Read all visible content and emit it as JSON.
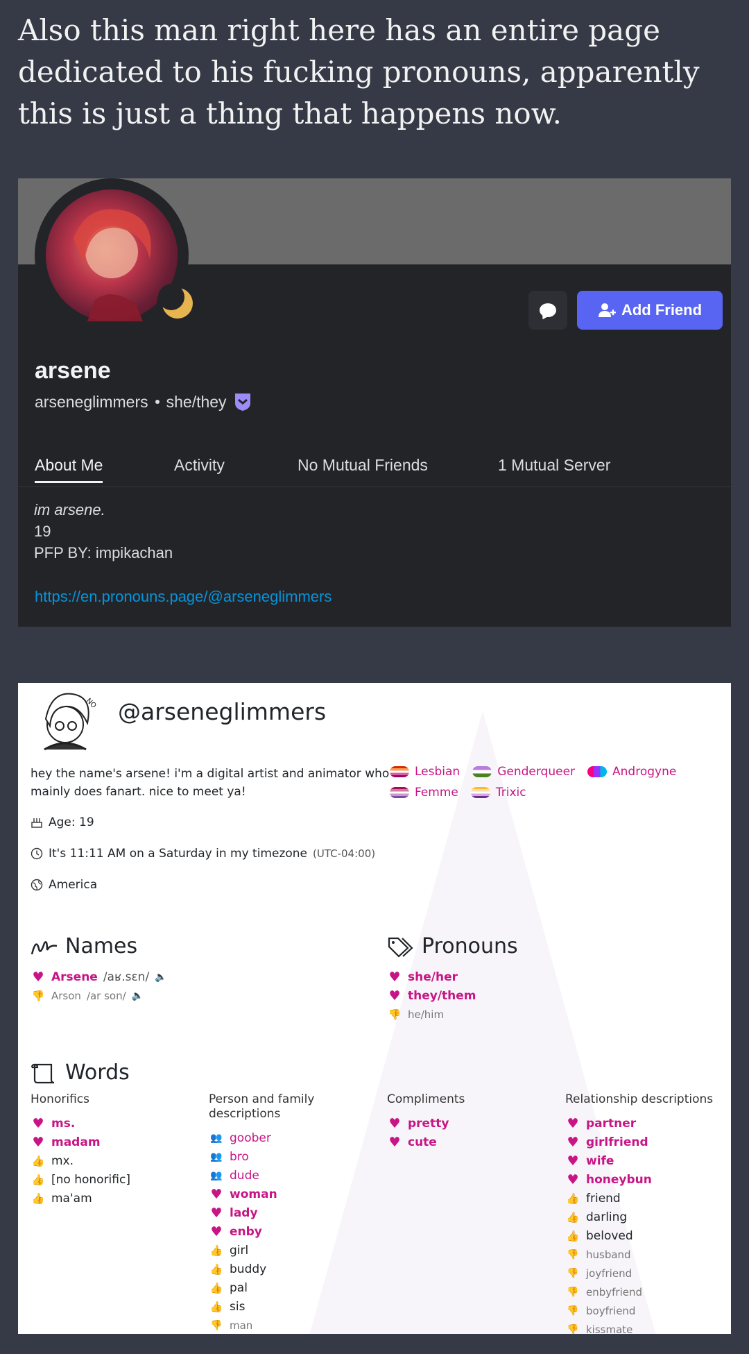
{
  "post": {
    "text": "Also this man right here has an entire page dedicated to his fucking pronouns, apparently this is just a thing that happens now."
  },
  "discord": {
    "display_name": "arsene",
    "username": "arseneglimmers",
    "pronouns": "she/they",
    "add_friend_label": "Add Friend",
    "tabs": [
      "About Me",
      "Activity",
      "No Mutual Friends",
      "1 Mutual Server"
    ],
    "about": {
      "line1": "im arsene.",
      "line2": "19",
      "line3": "PFP BY: impikachan",
      "link": "https://en.pronouns.page/@arseneglimmers"
    },
    "colors": {
      "accent": "#5865f2",
      "background": "#232428",
      "banner": "#6b6b6b",
      "status": "#e7b450"
    }
  },
  "pronouns_page": {
    "handle": "@arseneglimmers",
    "bio": "hey the name's arsene! i'm a digital artist and animator who mainly does fanart. nice to meet ya!",
    "flags": [
      {
        "label": "Lesbian",
        "colors": [
          "#d52d00",
          "#ff9a56",
          "#ffffff",
          "#d362a4",
          "#a30262"
        ]
      },
      {
        "label": "Genderqueer",
        "colors": [
          "#b57edc",
          "#ffffff",
          "#4a8123"
        ]
      },
      {
        "label": "Androgyne",
        "colors": [
          "#fe007f",
          "#9832ff",
          "#00b8e7"
        ]
      },
      {
        "label": "Femme",
        "colors": [
          "#a70b59",
          "#d07b9d",
          "#ffffff",
          "#c59bd0",
          "#7f4ba1"
        ]
      },
      {
        "label": "Trixic",
        "colors": [
          "#fcbb2e",
          "#ffdfa6",
          "#ffffff",
          "#d8a5e8",
          "#6b2c8e"
        ]
      }
    ],
    "age": "Age: 19",
    "time_text": "It's 11:11 AM on a Saturday in my timezone",
    "time_zone": "(UTC-04:00)",
    "location": "America",
    "names_title": "Names",
    "names": [
      {
        "name": "Arsene",
        "ipa": "/aʁ.sɛn/",
        "level": "yes"
      },
      {
        "name": "Arson",
        "ipa": "/ar son/",
        "level": "meh"
      }
    ],
    "pronouns_title": "Pronouns",
    "pronouns": [
      {
        "label": "she/her",
        "level": "yes"
      },
      {
        "label": "they/them",
        "level": "yes"
      },
      {
        "label": "he/him",
        "level": "meh"
      }
    ],
    "words_title": "Words",
    "word_columns": [
      {
        "heading": "Honorifics",
        "items": [
          {
            "label": "ms.",
            "level": "yes"
          },
          {
            "label": "madam",
            "level": "yes"
          },
          {
            "label": "mx.",
            "level": "ok"
          },
          {
            "label": "[no honorific]",
            "level": "ok"
          },
          {
            "label": "ma'am",
            "level": "ok"
          }
        ]
      },
      {
        "heading": "Person and family descriptions",
        "items": [
          {
            "label": "goober",
            "level": "close"
          },
          {
            "label": "bro",
            "level": "close"
          },
          {
            "label": "dude",
            "level": "close"
          },
          {
            "label": "woman",
            "level": "yes"
          },
          {
            "label": "lady",
            "level": "yes"
          },
          {
            "label": "enby",
            "level": "yes"
          },
          {
            "label": "girl",
            "level": "ok"
          },
          {
            "label": "buddy",
            "level": "ok"
          },
          {
            "label": "pal",
            "level": "ok"
          },
          {
            "label": "sis",
            "level": "ok"
          },
          {
            "label": "man",
            "level": "meh"
          }
        ]
      },
      {
        "heading": "Compliments",
        "items": [
          {
            "label": "pretty",
            "level": "yes"
          },
          {
            "label": "cute",
            "level": "yes"
          }
        ]
      },
      {
        "heading": "Relationship descriptions",
        "items": [
          {
            "label": "partner",
            "level": "yes"
          },
          {
            "label": "girlfriend",
            "level": "yes"
          },
          {
            "label": "wife",
            "level": "yes"
          },
          {
            "label": "honeybun",
            "level": "yes"
          },
          {
            "label": "friend",
            "level": "ok"
          },
          {
            "label": "darling",
            "level": "ok"
          },
          {
            "label": "beloved",
            "level": "ok"
          },
          {
            "label": "husband",
            "level": "meh"
          },
          {
            "label": "joyfriend",
            "level": "meh"
          },
          {
            "label": "enbyfriend",
            "level": "meh"
          },
          {
            "label": "boyfriend",
            "level": "meh"
          },
          {
            "label": "kissmate",
            "level": "meh"
          }
        ]
      }
    ],
    "colors": {
      "accent": "#c71585",
      "text": "#212529",
      "muted": "#777777"
    }
  }
}
